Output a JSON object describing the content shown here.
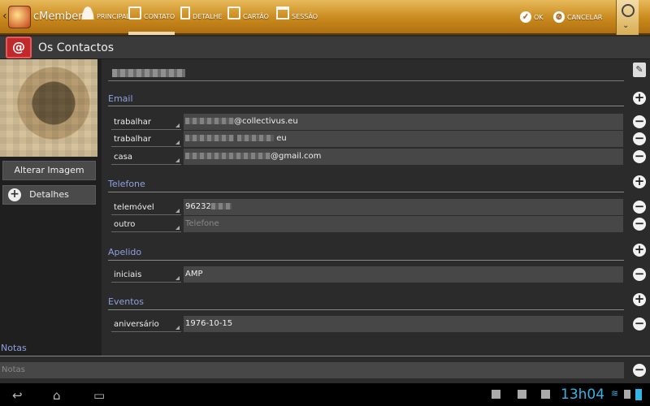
{
  "app": {
    "title": "cMember",
    "back_glyph": "‹"
  },
  "tabs": [
    {
      "label": "PRINCIPAL",
      "icon": "person-icon"
    },
    {
      "label": "CONTATO",
      "icon": "contact-card-icon",
      "active": true
    },
    {
      "label": "DETALHE",
      "icon": "document-icon"
    },
    {
      "label": "CARTÃO",
      "icon": "card-icon"
    },
    {
      "label": "SESSÃO",
      "icon": "calendar-icon"
    }
  ],
  "actions": {
    "ok": "OK",
    "cancel": "CANCELAR"
  },
  "header": {
    "title": "Os Contactos",
    "icon_glyph": "@"
  },
  "left_panel": {
    "change_image": "Alterar Imagem",
    "details": "Detalhes"
  },
  "email": {
    "title": "Email",
    "items": [
      {
        "type": "trabalhar",
        "value_suffix": "@collectivus.eu"
      },
      {
        "type": "trabalhar",
        "value_suffix": "eu"
      },
      {
        "type": "casa",
        "value_suffix": "@gmail.com"
      }
    ]
  },
  "phone": {
    "title": "Telefone",
    "items": [
      {
        "type": "telemóvel",
        "value": "96232"
      },
      {
        "type": "outro",
        "placeholder": "Telefone"
      }
    ]
  },
  "nickname": {
    "title": "Apelido",
    "items": [
      {
        "type": "iniciais",
        "value": "AMP"
      }
    ]
  },
  "events": {
    "title": "Eventos",
    "items": [
      {
        "type": "aniversário",
        "value": "1976-10-15"
      }
    ]
  },
  "notes": {
    "title": "Notas",
    "placeholder": "Notas"
  },
  "system": {
    "time": "13h04"
  },
  "colors": {
    "actionbar": "#c98a1e",
    "section_label": "#8fa0e0",
    "clock": "#33b5e5",
    "header_icon": "#c0282b"
  }
}
